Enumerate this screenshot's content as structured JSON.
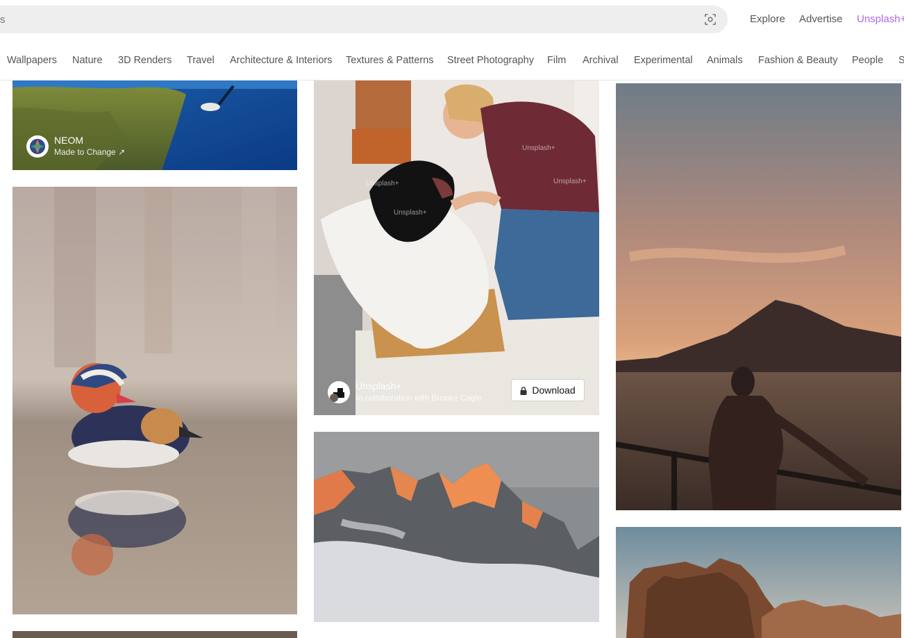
{
  "search": {
    "placeholder_partial": "s",
    "visual_search_icon": "camera-scan-icon"
  },
  "topnav": {
    "explore": "Explore",
    "advertise": "Advertise",
    "unsplash_plus": "Unsplash+"
  },
  "categories": [
    "Wallpapers",
    "Nature",
    "3D Renders",
    "Travel",
    "Architecture & Interiors",
    "Textures & Patterns",
    "Street Photography",
    "Film",
    "Archival",
    "Experimental",
    "Animals",
    "Fashion & Beauty",
    "People",
    "S"
  ],
  "photos": {
    "reef": {
      "title": "NEOM",
      "subtitle": "Made to Change ↗",
      "description": "diver over coral reef"
    },
    "duck": {
      "description": "mandarin duck reflection"
    },
    "dog": {
      "title": "Unsplash+",
      "subtitle": "In collaboration with Brooke Cagle",
      "download_label": "Download",
      "description": "woman laughing with dog",
      "watermarks": [
        "Unsplash+",
        "Unsplash+",
        "Unsplash+",
        "Unsplash+"
      ]
    },
    "mountain": {
      "description": "snowy mountain ridge at sunset"
    },
    "sunset": {
      "description": "woman at lake with volcano at sunset"
    },
    "desert": {
      "description": "desert rock formations"
    }
  },
  "colors": {
    "accent_plus": "#b266e6",
    "search_bg": "#eeeeee",
    "text_muted": "#555555"
  }
}
